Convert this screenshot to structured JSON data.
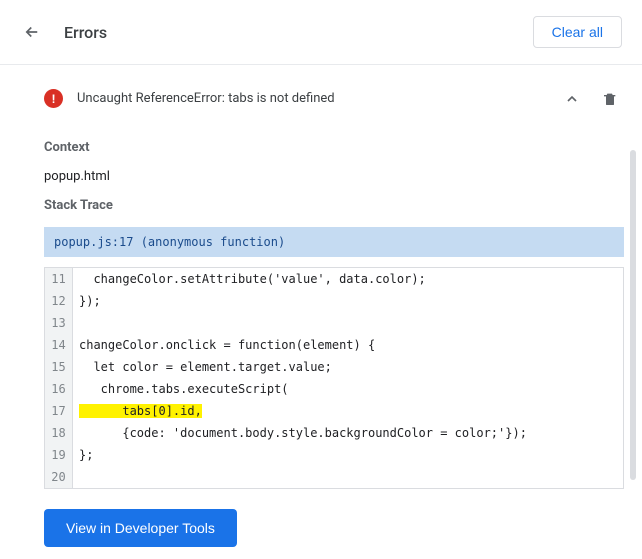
{
  "header": {
    "title": "Errors",
    "clear_all": "Clear all"
  },
  "error": {
    "message": "Uncaught ReferenceError: tabs is not defined",
    "badge": "!"
  },
  "sections": {
    "context_heading": "Context",
    "context_value": "popup.html",
    "stack_trace_heading": "Stack Trace",
    "stack_trace_label": "popup.js:17 (anonymous function)"
  },
  "code": {
    "lines": [
      {
        "num": "11",
        "text": "  changeColor.setAttribute('value', data.color);",
        "hl": false
      },
      {
        "num": "12",
        "text": "});",
        "hl": false
      },
      {
        "num": "13",
        "text": "",
        "hl": false
      },
      {
        "num": "14",
        "text": "changeColor.onclick = function(element) {",
        "hl": false
      },
      {
        "num": "15",
        "text": "  let color = element.target.value;",
        "hl": false
      },
      {
        "num": "16",
        "text": "   chrome.tabs.executeScript(",
        "hl": false
      },
      {
        "num": "17",
        "text": "      tabs[0].id,",
        "hl": true
      },
      {
        "num": "18",
        "text": "      {code: 'document.body.style.backgroundColor = color;'});",
        "hl": false
      },
      {
        "num": "19",
        "text": "};",
        "hl": false
      },
      {
        "num": "20",
        "text": "",
        "hl": false
      }
    ]
  },
  "footer": {
    "dev_tools": "View in Developer Tools"
  }
}
